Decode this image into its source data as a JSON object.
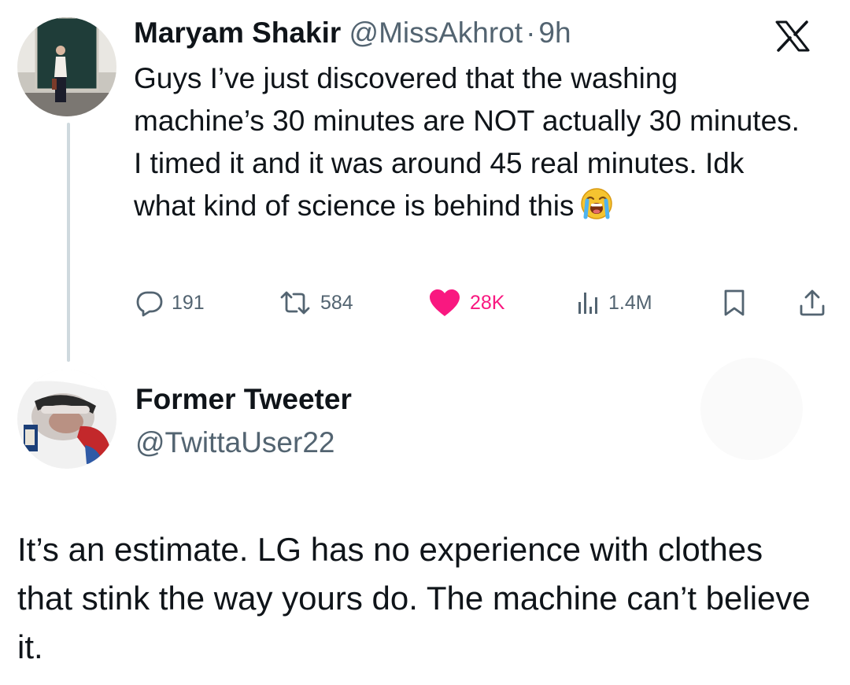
{
  "tweet": {
    "author_name": "Maryam Shakir",
    "author_handle": "@MissAkhrot",
    "separator": "·",
    "time": "9h",
    "text": "Guys I’ve just discovered that the washing machine’s 30 minutes are NOT actually 30 minutes. I timed it and it was around 45 real minutes. Idk what kind of science is behind this",
    "emoji": "loudly-crying-face-emoji",
    "stats": {
      "replies": "191",
      "retweets": "584",
      "likes": "28K",
      "views": "1.4M"
    },
    "icons": {
      "reply": "comment-bubble-icon",
      "retweet": "retweet-icon",
      "like": "heart-icon",
      "views": "bar-chart-icon",
      "bookmark": "bookmark-icon",
      "share": "share-icon",
      "brand": "x-logo-icon"
    },
    "like_color": "#f91880"
  },
  "reply": {
    "author_name": "Former Tweeter",
    "author_handle": "@TwittaUser22",
    "text": "It’s an estimate. LG has no experience with clothes that stink the way yours do. The machine can’t believe it."
  },
  "colors": {
    "text_primary": "#0f1419",
    "text_secondary": "#536471",
    "thread_line": "#cfd9de"
  }
}
